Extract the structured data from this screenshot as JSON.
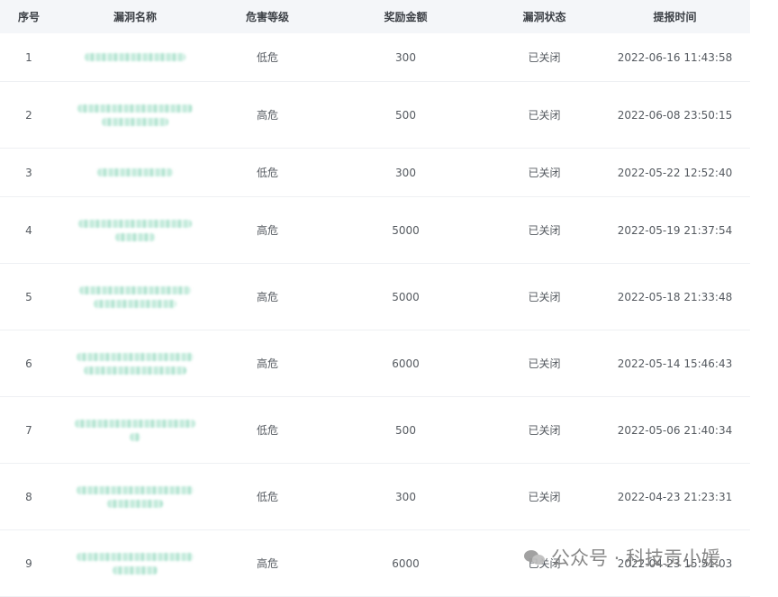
{
  "table": {
    "headers": {
      "index": "序号",
      "name": "漏洞名称",
      "level": "危害等级",
      "amount": "奖励金额",
      "status": "漏洞状态",
      "time": "提报时间"
    },
    "rows": [
      {
        "index": "1",
        "level": "低危",
        "amount": "300",
        "status": "已关闭",
        "time": "2022-06-16 11:43:58"
      },
      {
        "index": "2",
        "level": "高危",
        "amount": "500",
        "status": "已关闭",
        "time": "2022-06-08 23:50:15"
      },
      {
        "index": "3",
        "level": "低危",
        "amount": "300",
        "status": "已关闭",
        "time": "2022-05-22 12:52:40"
      },
      {
        "index": "4",
        "level": "高危",
        "amount": "5000",
        "status": "已关闭",
        "time": "2022-05-19 21:37:54"
      },
      {
        "index": "5",
        "level": "高危",
        "amount": "5000",
        "status": "已关闭",
        "time": "2022-05-18 21:33:48"
      },
      {
        "index": "6",
        "level": "高危",
        "amount": "6000",
        "status": "已关闭",
        "time": "2022-05-14 15:46:43"
      },
      {
        "index": "7",
        "level": "低危",
        "amount": "500",
        "status": "已关闭",
        "time": "2022-05-06 21:40:34"
      },
      {
        "index": "8",
        "level": "低危",
        "amount": "300",
        "status": "已关闭",
        "time": "2022-04-23 21:23:31"
      },
      {
        "index": "9",
        "level": "高危",
        "amount": "6000",
        "status": "已关闭",
        "time": "2022-04-23 15:51:03"
      }
    ]
  },
  "watermark": {
    "icon": "wechat-logo-icon",
    "text": "公众号 · 科技贡小媛"
  }
}
